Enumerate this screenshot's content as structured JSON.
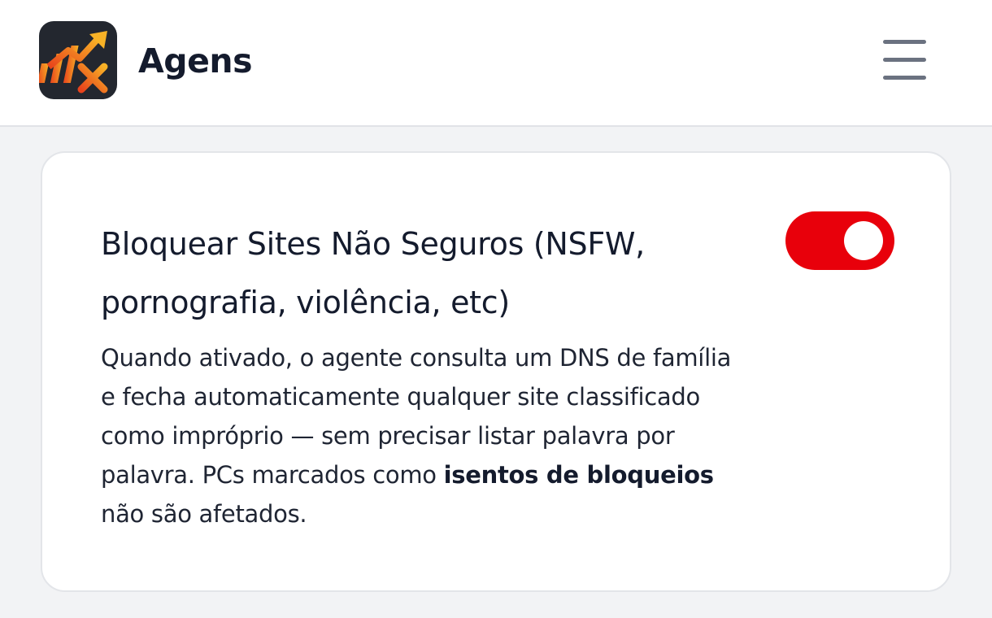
{
  "header": {
    "app_title": "Agens",
    "logo_icon": "chart-arrow-logo-icon",
    "menu_icon": "hamburger-menu-icon"
  },
  "setting": {
    "title": "Bloquear Sites Não Seguros (NSFW, pornografia, violência, etc)",
    "description_part1": "Quando ativado, o agente consulta um DNS de família e fecha automaticamente qualquer site classificado como impróprio — sem precisar listar palavra por palavra. PCs marcados como ",
    "description_bold": "isentos de bloqueios",
    "description_part2": " não são afetados.",
    "toggle_on": true,
    "toggle_color": "#e8000b"
  },
  "colors": {
    "background": "#f2f3f5",
    "card": "#ffffff",
    "text": "#141b2d"
  }
}
